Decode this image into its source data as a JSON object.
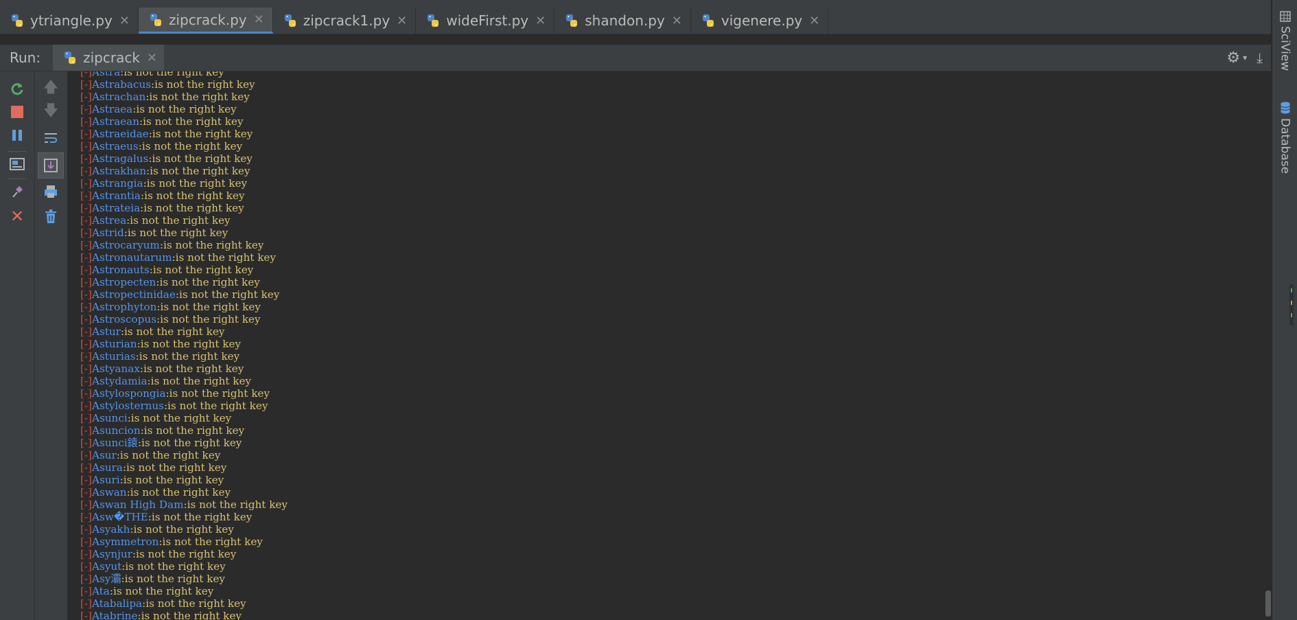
{
  "tabs": [
    {
      "label": "ytriangle.py",
      "active": false
    },
    {
      "label": "zipcrack.py",
      "active": true
    },
    {
      "label": "zipcrack1.py",
      "active": false
    },
    {
      "label": "wideFirst.py",
      "active": false
    },
    {
      "label": "shandon.py",
      "active": false
    },
    {
      "label": "vigenere.py",
      "active": false
    }
  ],
  "run": {
    "label": "Run:",
    "config": "zipcrack"
  },
  "right_panels": [
    "SciView",
    "Database"
  ],
  "console": {
    "prefix": "[-]",
    "message": ":is not the right key",
    "words": [
      "Astra",
      "Astrabacus",
      "Astrachan",
      "Astraea",
      "Astraean",
      "Astraeidae",
      "Astraeus",
      "Astragalus",
      "Astrakhan",
      "Astrangia",
      "Astrantia",
      "Astrateia",
      "Astrea",
      "Astrid",
      "Astrocaryum",
      "Astronautarum",
      "Astronauts",
      "Astropecten",
      "Astropectinidae",
      "Astrophyton",
      "Astroscopus",
      "Astur",
      "Asturian",
      "Asturias",
      "Astyanax",
      "Astydamia",
      "Astylospongia",
      "Astylosternus",
      "Asunci",
      "Asuncion",
      "Asunci鎱",
      "Asur",
      "Asura",
      "Asuri",
      "Aswan",
      "Aswan High Dam",
      "Asw�THE",
      "Asyakh",
      "Asymmetron",
      "Asynjur",
      "Asyut",
      "Asy灞",
      "Ata",
      "Atabalipa",
      "Atabrine"
    ]
  }
}
